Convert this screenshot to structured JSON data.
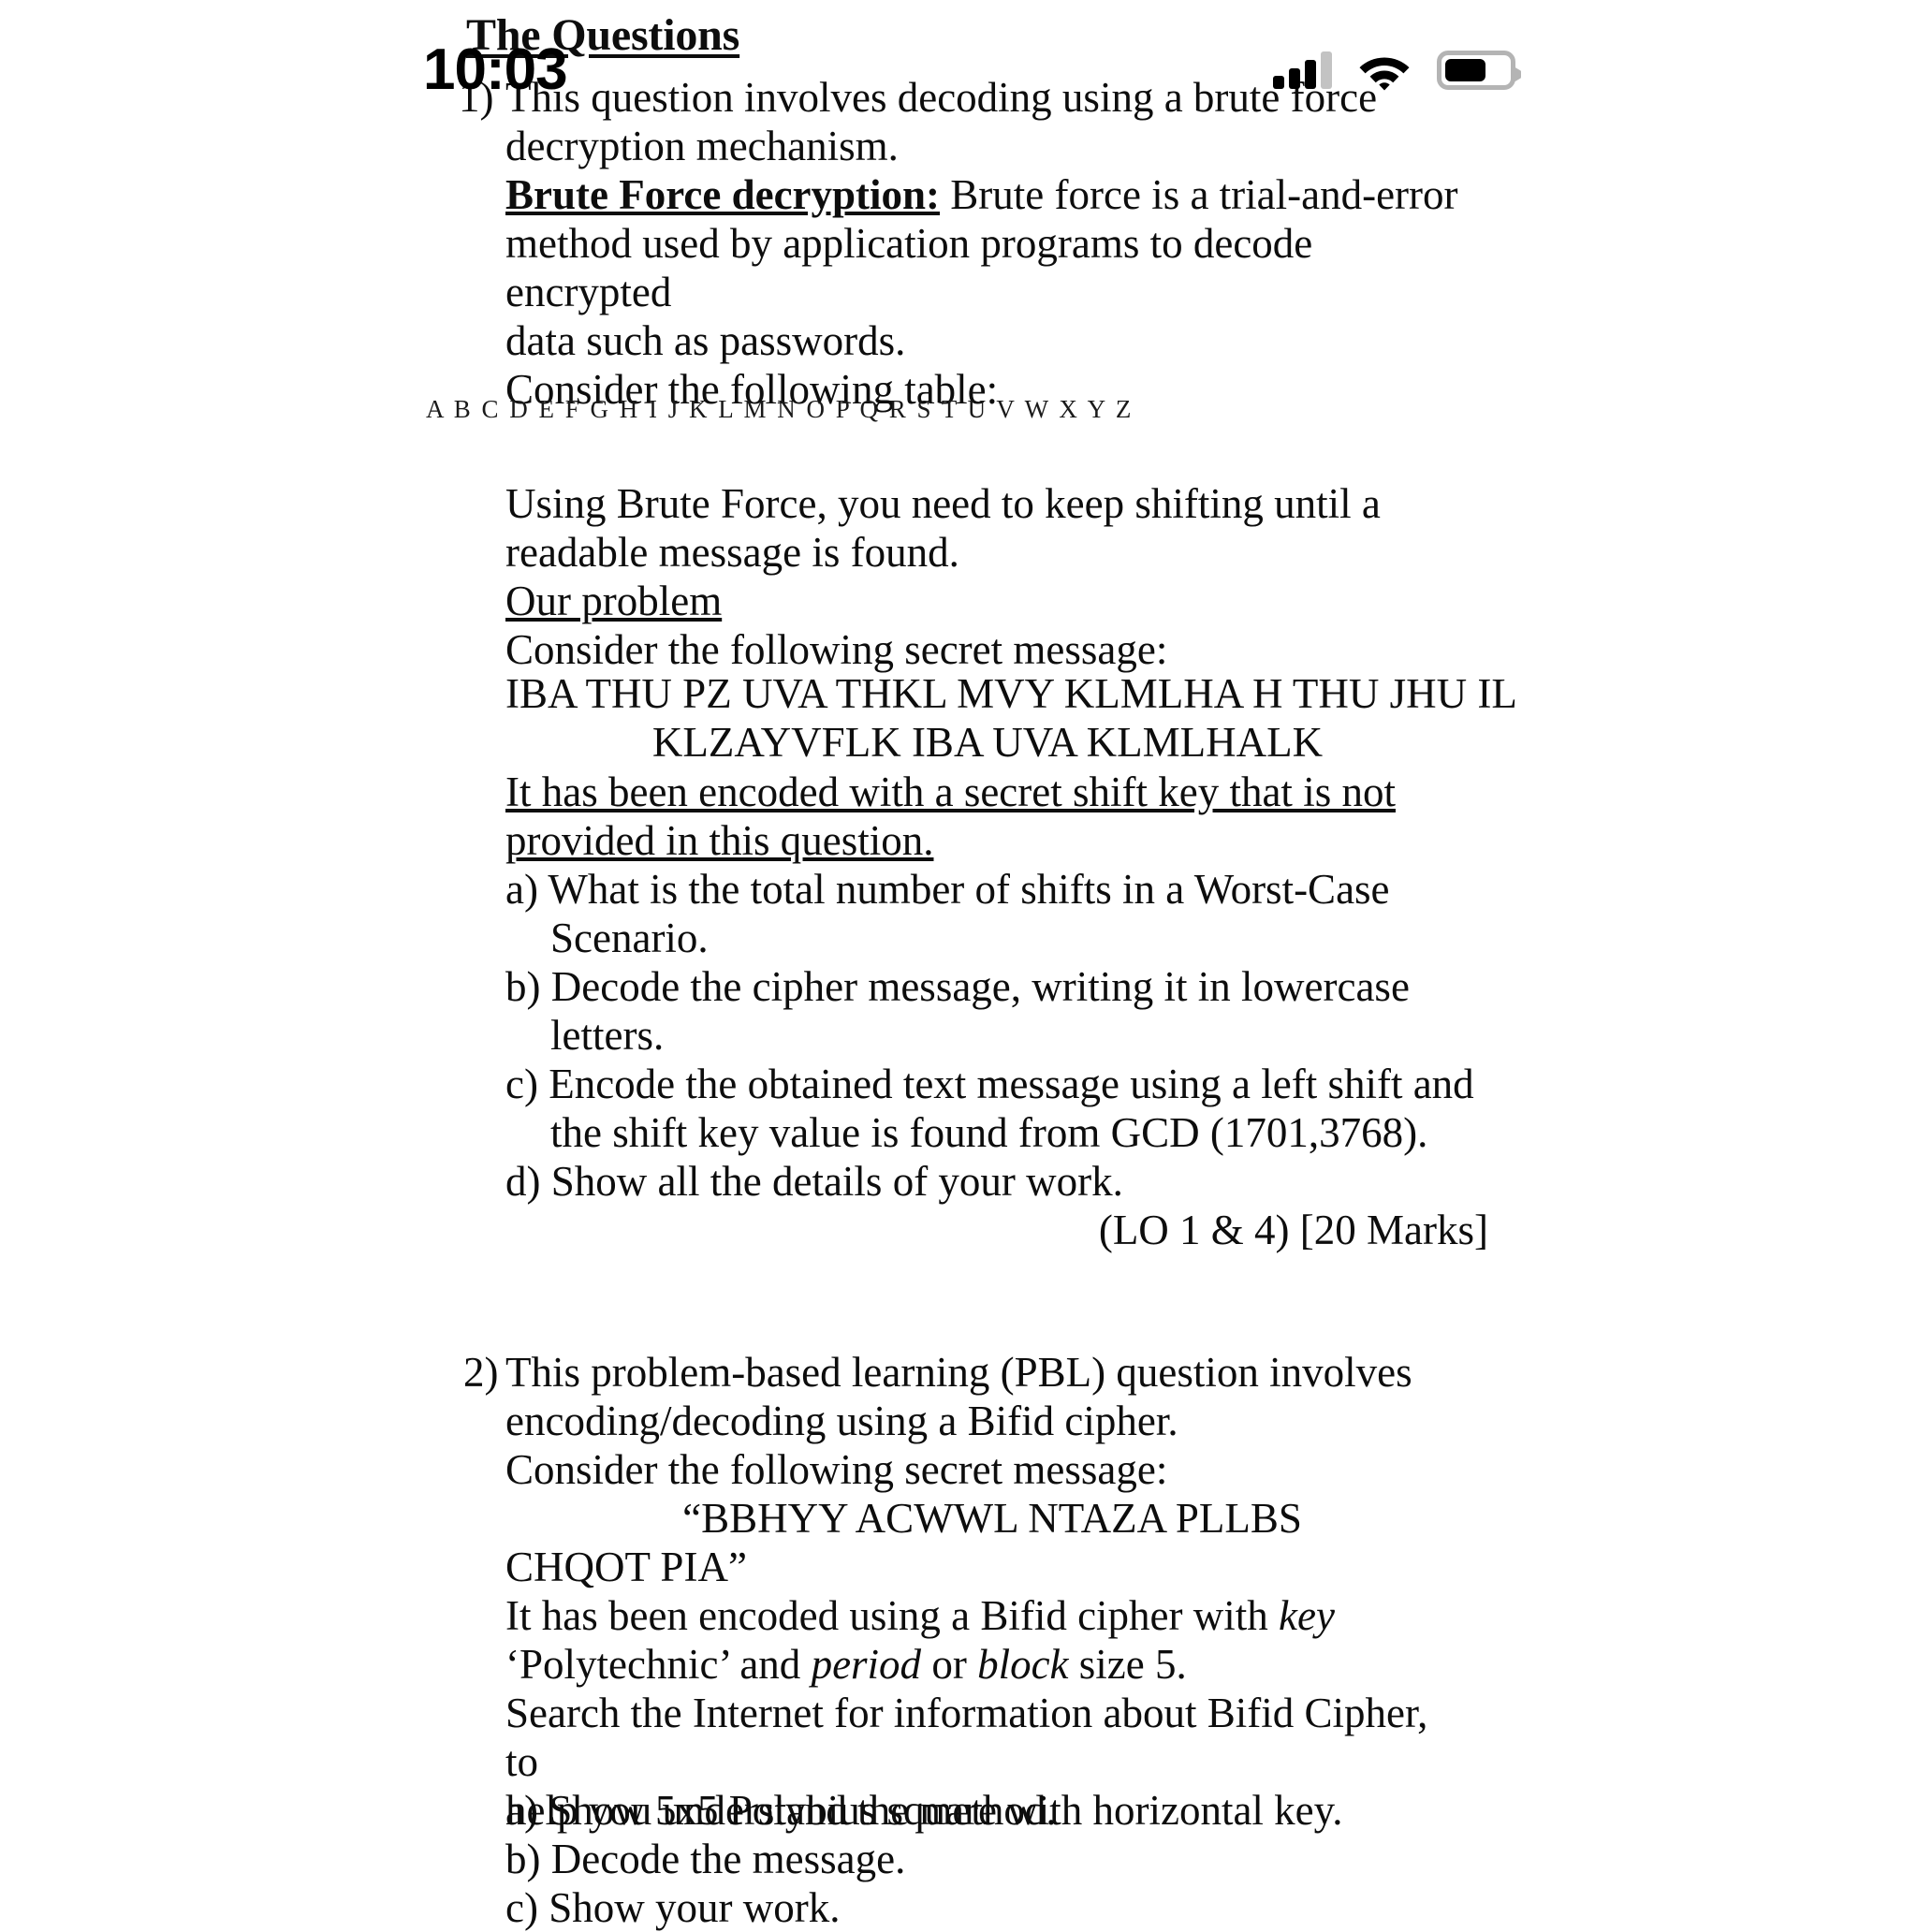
{
  "status_bar": {
    "clock": "10:03",
    "signal_icon": "cellular-signal-icon",
    "wifi_icon": "wifi-icon",
    "battery_icon": "battery-icon",
    "battery_level_percent": 65,
    "battery_fill_color": "#000000",
    "battery_outline_color": "#b4b4b4",
    "signal_active_color": "#000000",
    "signal_inactive_color": "#c3c3c3"
  },
  "document": {
    "title": "The Questions",
    "alphabet_table": "A B C D E F G H I J K L M N O P Q R S T U V W X Y Z",
    "questions": [
      {
        "number": "1)",
        "intro_line_1": "This question involves decoding using a brute force",
        "intro_line_2": "decryption mechanism.",
        "definition_label": "Brute Force decryption:",
        "definition_text": " Brute force is a trial-and-error",
        "definition_line_2": "method used by application programs to decode encrypted",
        "definition_line_3": "data such as passwords.",
        "consider_table": "Consider the following table:",
        "using_line_1": "Using Brute Force, you need to keep shifting until a",
        "using_line_2": "readable message is found.",
        "our_problem": "Our problem",
        "consider_message": "Consider the following secret message:",
        "cipher_line_1": "IBA THU PZ UVA THKL MVY KLMLHA H THU JHU IL",
        "cipher_line_2": "KLZAYVFLK IBA UVA KLMLHALK",
        "note_line_1": "It has been encoded with a secret shift key that is not",
        "note_line_2": "provided in this question.",
        "items": [
          {
            "label": "a)",
            "text": "What is the total number of shifts in a Worst-Case Scenario."
          },
          {
            "label": "b)",
            "text": "Decode the cipher message, writing it in lowercase letters."
          },
          {
            "label": "c)",
            "text": "Encode the obtained text message using a left shift and the shift key value is found from GCD (1701,3768)."
          },
          {
            "label": "d)",
            "text": "Show all the details of your work."
          }
        ],
        "marks": "(LO 1 & 4) [20 Marks]"
      },
      {
        "number": "2)",
        "intro_line_1": "This problem-based learning (PBL) question involves",
        "intro_line_2": "encoding/decoding using a Bifid cipher.",
        "consider_message": "Consider the following secret message:",
        "cipher_line_1": "“BBHYY ACWWL NTAZA PLLBS",
        "cipher_line_2": "CHQOT PIA”",
        "encoded_pre": "It has been encoded using a Bifid cipher with ",
        "encoded_key_word": "key",
        "encoded_line2_pre": "‘Polytechnic’ and ",
        "encoded_period_word": "period",
        "encoded_line2_mid": " or ",
        "encoded_block_word": "block",
        "encoded_line2_post": " size 5.",
        "search_line_1": "Search the Internet for information about Bifid Cipher, to",
        "search_line_2": "help you understand the method.",
        "items": [
          {
            "label": "a)",
            "text": "Show 5x5 Polybius square with horizontal key."
          },
          {
            "label": "b)",
            "text": "Decode the message."
          },
          {
            "label": "c)",
            "text": "Show your work."
          }
        ]
      }
    ]
  }
}
